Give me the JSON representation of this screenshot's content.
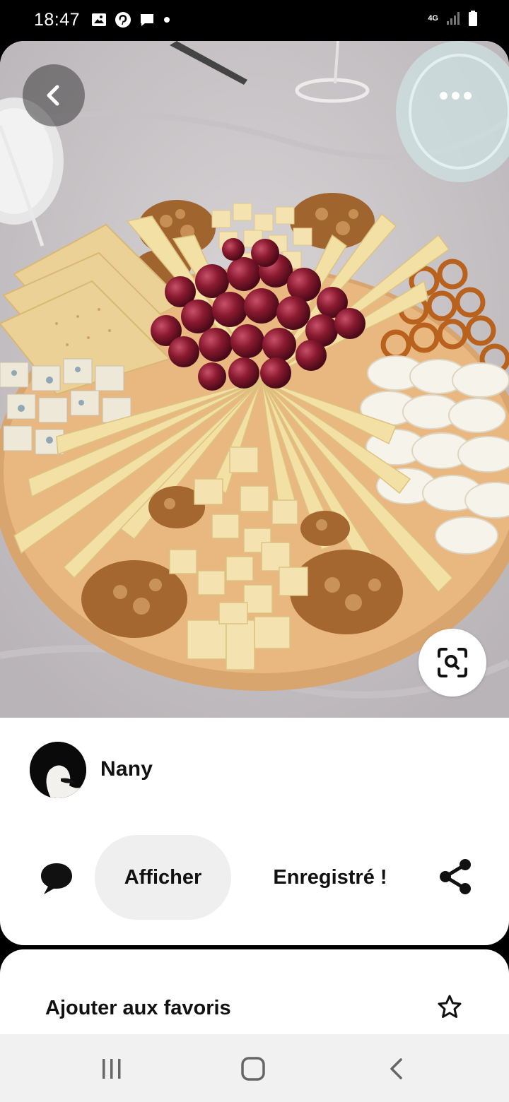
{
  "status_bar": {
    "time": "18:47",
    "network": "4G",
    "left_icons": [
      "gallery-icon",
      "pinterest-icon",
      "chat-bubble-icon",
      "dot-icon"
    ],
    "right_icons": [
      "signal-icon",
      "battery-icon"
    ]
  },
  "pin": {
    "image_subject": "cheese-platter",
    "author_name": "Nany",
    "view_button_label": "Afficher",
    "saved_label": "Enregistré !"
  },
  "favorites": {
    "label": "Ajouter aux favoris"
  },
  "colors": {
    "button_bg": "#efefef",
    "text": "#111111",
    "nav_bg": "#f1f1f1"
  }
}
